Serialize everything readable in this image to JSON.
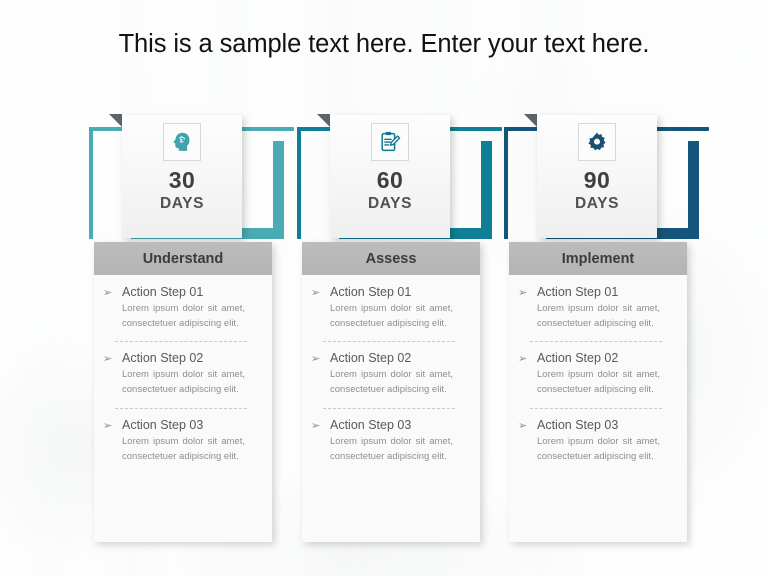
{
  "title": "This is a sample text here. Enter your text here.",
  "colors": {
    "bracket_1": "#4aabb4",
    "bracket_2": "#0e7f96",
    "bracket_3": "#14557a",
    "panel_header_bg": "#b7b7b7",
    "title_text": "#121212"
  },
  "columns": [
    {
      "icon": "head-brain-icon",
      "icon_color": "#3fa2ac",
      "accent": "#4aabb4",
      "day_number": "30",
      "day_label": "DAYS",
      "heading": "Understand",
      "steps": [
        {
          "title": "Action Step 01",
          "desc": "Lorem ipsum dolor sit amet, consectetuer adipiscing elit."
        },
        {
          "title": "Action Step 02",
          "desc": "Lorem ipsum dolor sit amet, consectetuer adipiscing elit."
        },
        {
          "title": "Action Step 03",
          "desc": "Lorem ipsum dolor sit amet, consectetuer adipiscing elit."
        }
      ]
    },
    {
      "icon": "clipboard-pencil-icon",
      "icon_color": "#11798f",
      "accent": "#0e7f96",
      "day_number": "60",
      "day_label": "DAYS",
      "heading": "Assess",
      "steps": [
        {
          "title": "Action Step 01",
          "desc": "Lorem ipsum dolor sit amet, consectetuer adipiscing elit."
        },
        {
          "title": "Action Step 02",
          "desc": "Lorem ipsum dolor sit amet, consectetuer adipiscing elit."
        },
        {
          "title": "Action Step 03",
          "desc": "Lorem ipsum dolor sit amet, consectetuer adipiscing elit."
        }
      ]
    },
    {
      "icon": "gear-icon",
      "icon_color": "#1b4f72",
      "accent": "#14557a",
      "day_number": "90",
      "day_label": "DAYS",
      "heading": "Implement",
      "steps": [
        {
          "title": "Action Step 01",
          "desc": "Lorem ipsum dolor sit amet, consectetuer adipiscing elit."
        },
        {
          "title": "Action Step 02",
          "desc": "Lorem ipsum dolor sit amet, consectetuer adipiscing elit."
        },
        {
          "title": "Action Step 03",
          "desc": "Lorem ipsum dolor sit amet, consectetuer adipiscing elit."
        }
      ]
    }
  ],
  "bullet_glyph": "➢"
}
